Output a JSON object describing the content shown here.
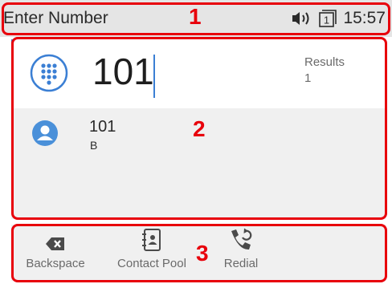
{
  "status_bar": {
    "title": "Enter Number",
    "time": "15:57",
    "icons": [
      "speaker-icon",
      "line-1-icon"
    ],
    "line_number": "1"
  },
  "annotations": [
    "1",
    "2",
    "3"
  ],
  "dial_entry": {
    "value": "101",
    "results_label": "Results",
    "results_count": "1"
  },
  "contacts": [
    {
      "number": "101",
      "name": "B"
    }
  ],
  "softkeys": {
    "backspace": "Backspace",
    "contact_pool": "Contact Pool",
    "redial": "Redial"
  },
  "colors": {
    "accent": "#3b7fd4",
    "annotation": "#e8000b",
    "status_bar_bg": "#e5e5e5",
    "panel_bg": "#f0f0f0"
  }
}
